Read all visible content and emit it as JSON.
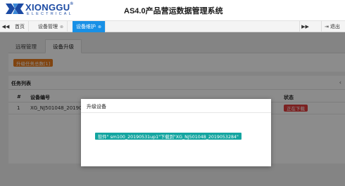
{
  "header": {
    "logo_text": "XIONGGU",
    "logo_reg": "®",
    "logo_sub": "ELECTRICAL",
    "app_title": "AS4.0产品营运数据管理系统"
  },
  "tabbar": {
    "tabs": [
      {
        "label": "首页",
        "closable": false,
        "active": false
      },
      {
        "label": "设备管理",
        "closable": true,
        "active": false
      },
      {
        "label": "设备维护",
        "closable": true,
        "active": true
      }
    ],
    "close_glyph": "⊗",
    "logout_label": "退出",
    "logout_icon": "⇥"
  },
  "subtabs": [
    {
      "label": "远程管理",
      "active": false
    },
    {
      "label": "设备升级",
      "active": true
    }
  ],
  "summary": {
    "badge": "升级任务总数[1]",
    "badge_color": "#e97c1e"
  },
  "task_list": {
    "title": "任务列表",
    "columns": [
      "#",
      "设备编号",
      "状态"
    ],
    "rows": [
      {
        "index": "1",
        "device_id": "XG_NJ501048_20190",
        "status": "正在下载"
      }
    ],
    "status_color": "#e23c3c"
  },
  "modal": {
    "title": "升级设备",
    "message": "软件\" sm100_20190531up1\"下载到\"XG_NJ501048_2019053284\"",
    "message_color": "#14a5a0"
  },
  "colors": {
    "brand": "#1b4aa3",
    "accent": "#1890e6"
  }
}
